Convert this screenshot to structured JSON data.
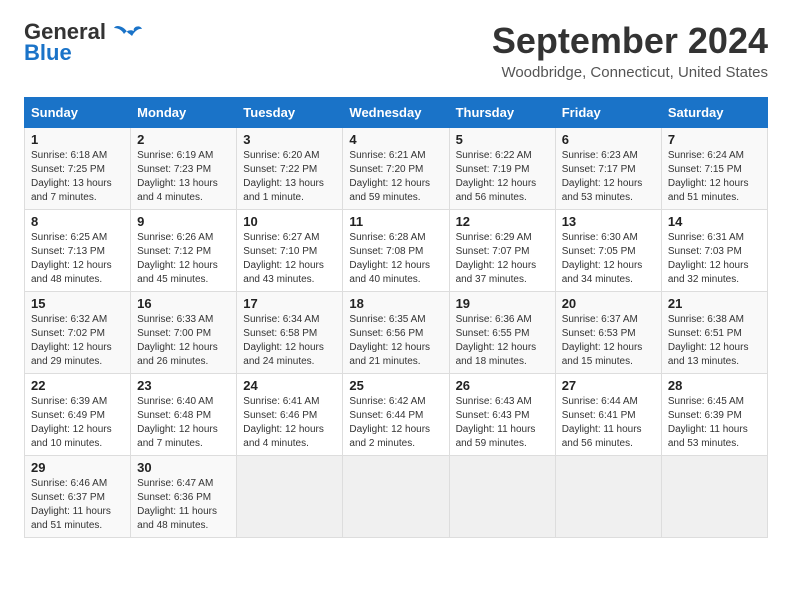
{
  "header": {
    "logo_line1": "General",
    "logo_line2": "Blue",
    "month": "September 2024",
    "location": "Woodbridge, Connecticut, United States"
  },
  "weekdays": [
    "Sunday",
    "Monday",
    "Tuesday",
    "Wednesday",
    "Thursday",
    "Friday",
    "Saturday"
  ],
  "weeks": [
    [
      {
        "day": "1",
        "sunrise": "6:18 AM",
        "sunset": "7:25 PM",
        "daylight": "13 hours and 7 minutes."
      },
      {
        "day": "2",
        "sunrise": "6:19 AM",
        "sunset": "7:23 PM",
        "daylight": "13 hours and 4 minutes."
      },
      {
        "day": "3",
        "sunrise": "6:20 AM",
        "sunset": "7:22 PM",
        "daylight": "13 hours and 1 minute."
      },
      {
        "day": "4",
        "sunrise": "6:21 AM",
        "sunset": "7:20 PM",
        "daylight": "12 hours and 59 minutes."
      },
      {
        "day": "5",
        "sunrise": "6:22 AM",
        "sunset": "7:19 PM",
        "daylight": "12 hours and 56 minutes."
      },
      {
        "day": "6",
        "sunrise": "6:23 AM",
        "sunset": "7:17 PM",
        "daylight": "12 hours and 53 minutes."
      },
      {
        "day": "7",
        "sunrise": "6:24 AM",
        "sunset": "7:15 PM",
        "daylight": "12 hours and 51 minutes."
      }
    ],
    [
      {
        "day": "8",
        "sunrise": "6:25 AM",
        "sunset": "7:13 PM",
        "daylight": "12 hours and 48 minutes."
      },
      {
        "day": "9",
        "sunrise": "6:26 AM",
        "sunset": "7:12 PM",
        "daylight": "12 hours and 45 minutes."
      },
      {
        "day": "10",
        "sunrise": "6:27 AM",
        "sunset": "7:10 PM",
        "daylight": "12 hours and 43 minutes."
      },
      {
        "day": "11",
        "sunrise": "6:28 AM",
        "sunset": "7:08 PM",
        "daylight": "12 hours and 40 minutes."
      },
      {
        "day": "12",
        "sunrise": "6:29 AM",
        "sunset": "7:07 PM",
        "daylight": "12 hours and 37 minutes."
      },
      {
        "day": "13",
        "sunrise": "6:30 AM",
        "sunset": "7:05 PM",
        "daylight": "12 hours and 34 minutes."
      },
      {
        "day": "14",
        "sunrise": "6:31 AM",
        "sunset": "7:03 PM",
        "daylight": "12 hours and 32 minutes."
      }
    ],
    [
      {
        "day": "15",
        "sunrise": "6:32 AM",
        "sunset": "7:02 PM",
        "daylight": "12 hours and 29 minutes."
      },
      {
        "day": "16",
        "sunrise": "6:33 AM",
        "sunset": "7:00 PM",
        "daylight": "12 hours and 26 minutes."
      },
      {
        "day": "17",
        "sunrise": "6:34 AM",
        "sunset": "6:58 PM",
        "daylight": "12 hours and 24 minutes."
      },
      {
        "day": "18",
        "sunrise": "6:35 AM",
        "sunset": "6:56 PM",
        "daylight": "12 hours and 21 minutes."
      },
      {
        "day": "19",
        "sunrise": "6:36 AM",
        "sunset": "6:55 PM",
        "daylight": "12 hours and 18 minutes."
      },
      {
        "day": "20",
        "sunrise": "6:37 AM",
        "sunset": "6:53 PM",
        "daylight": "12 hours and 15 minutes."
      },
      {
        "day": "21",
        "sunrise": "6:38 AM",
        "sunset": "6:51 PM",
        "daylight": "12 hours and 13 minutes."
      }
    ],
    [
      {
        "day": "22",
        "sunrise": "6:39 AM",
        "sunset": "6:49 PM",
        "daylight": "12 hours and 10 minutes."
      },
      {
        "day": "23",
        "sunrise": "6:40 AM",
        "sunset": "6:48 PM",
        "daylight": "12 hours and 7 minutes."
      },
      {
        "day": "24",
        "sunrise": "6:41 AM",
        "sunset": "6:46 PM",
        "daylight": "12 hours and 4 minutes."
      },
      {
        "day": "25",
        "sunrise": "6:42 AM",
        "sunset": "6:44 PM",
        "daylight": "12 hours and 2 minutes."
      },
      {
        "day": "26",
        "sunrise": "6:43 AM",
        "sunset": "6:43 PM",
        "daylight": "11 hours and 59 minutes."
      },
      {
        "day": "27",
        "sunrise": "6:44 AM",
        "sunset": "6:41 PM",
        "daylight": "11 hours and 56 minutes."
      },
      {
        "day": "28",
        "sunrise": "6:45 AM",
        "sunset": "6:39 PM",
        "daylight": "11 hours and 53 minutes."
      }
    ],
    [
      {
        "day": "29",
        "sunrise": "6:46 AM",
        "sunset": "6:37 PM",
        "daylight": "11 hours and 51 minutes."
      },
      {
        "day": "30",
        "sunrise": "6:47 AM",
        "sunset": "6:36 PM",
        "daylight": "11 hours and 48 minutes."
      },
      null,
      null,
      null,
      null,
      null
    ]
  ]
}
